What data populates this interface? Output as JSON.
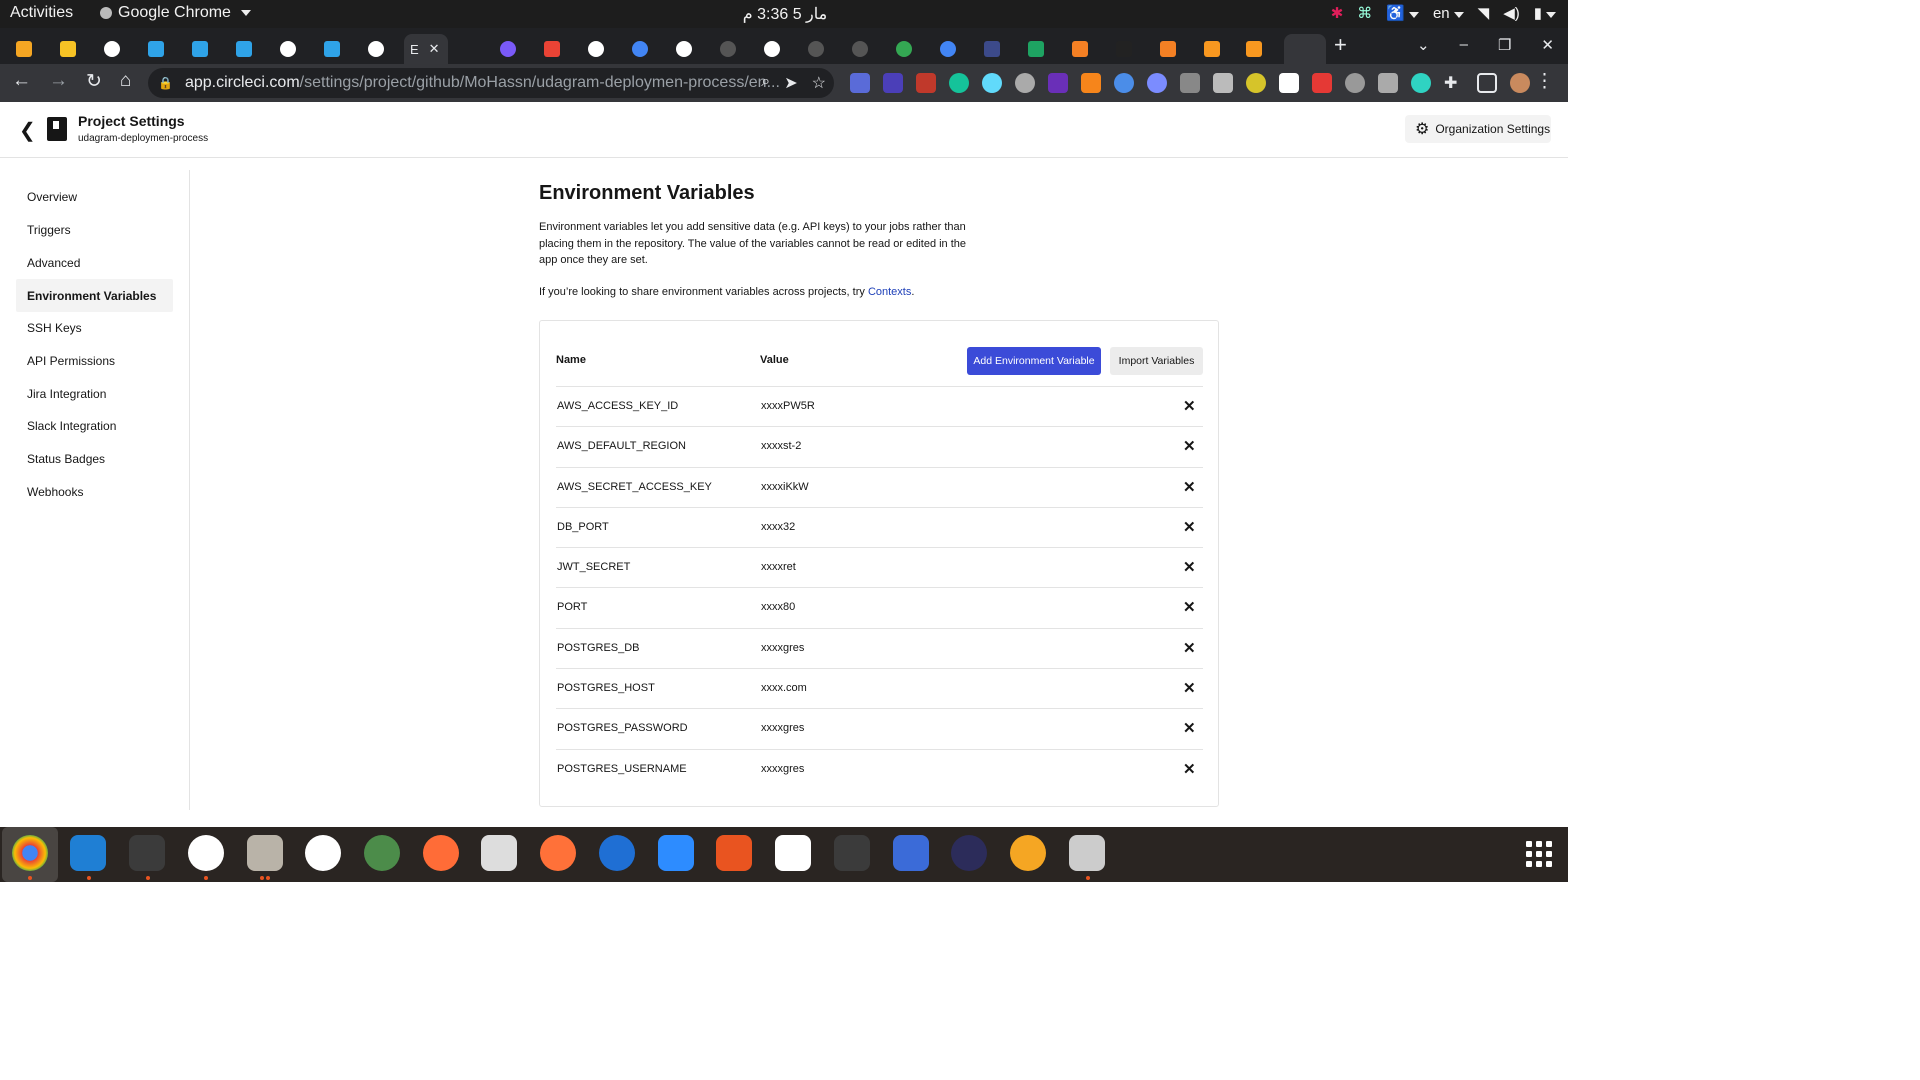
{
  "system_bar": {
    "activities": "Activities",
    "app_name": "Google Chrome",
    "clock": "مار 5  3:36 م",
    "language": "en"
  },
  "browser": {
    "active_tab_label": "E",
    "url_host": "app.circleci.com",
    "url_path": "/settings/project/github/MoHassn/udagram-deploymen-process/en..."
  },
  "header": {
    "title": "Project Settings",
    "subtitle": "udagram-deploymen-process",
    "org_settings_label": "Organization Settings"
  },
  "sidebar": {
    "items": [
      {
        "label": "Overview"
      },
      {
        "label": "Triggers"
      },
      {
        "label": "Advanced"
      },
      {
        "label": "Environment Variables",
        "selected": true
      },
      {
        "label": "SSH Keys"
      },
      {
        "label": "API Permissions"
      },
      {
        "label": "Jira Integration"
      },
      {
        "label": "Slack Integration"
      },
      {
        "label": "Status Badges"
      },
      {
        "label": "Webhooks"
      }
    ]
  },
  "main": {
    "heading": "Environment Variables",
    "description": "Environment variables let you add sensitive data (e.g. API keys) to your jobs rather than placing them in the repository. The value of the variables cannot be read or edited in the app once they are set.",
    "hint_prefix": "If you’re looking to share environment variables across projects, try ",
    "hint_link": "Contexts",
    "hint_suffix": ".",
    "table": {
      "name_header": "Name",
      "value_header": "Value",
      "add_button": "Add Environment Variable",
      "import_button": "Import Variables",
      "rows": [
        {
          "name": "AWS_ACCESS_KEY_ID",
          "value": "xxxxPW5R"
        },
        {
          "name": "AWS_DEFAULT_REGION",
          "value": "xxxxst-2"
        },
        {
          "name": "AWS_SECRET_ACCESS_KEY",
          "value": "xxxxiKkW"
        },
        {
          "name": "DB_PORT",
          "value": "xxxx32"
        },
        {
          "name": "JWT_SECRET",
          "value": "xxxxret"
        },
        {
          "name": "PORT",
          "value": "xxxx80"
        },
        {
          "name": "POSTGRES_DB",
          "value": "xxxxgres"
        },
        {
          "name": "POSTGRES_HOST",
          "value": "xxxx.com"
        },
        {
          "name": "POSTGRES_PASSWORD",
          "value": "xxxxgres"
        },
        {
          "name": "POSTGRES_USERNAME",
          "value": "xxxxgres"
        }
      ]
    }
  },
  "dock": {
    "apps": [
      "chrome",
      "vscode",
      "terminal",
      "slack",
      "files",
      "mongodb-compass",
      "postman-rocket",
      "postman",
      "settings",
      "firefox",
      "thunderbird",
      "zoom",
      "app-center",
      "code-editor",
      "system-monitor",
      "screenshot",
      "eclipse",
      "todo",
      "image-viewer"
    ]
  },
  "colors": {
    "accent": "#3b4bd8",
    "link": "#1d3fb8"
  }
}
